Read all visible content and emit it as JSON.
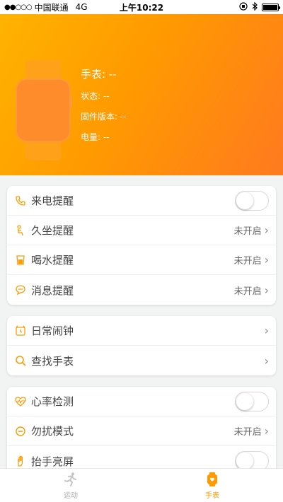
{
  "status_bar": {
    "carrier": "中国联通",
    "network": "4G",
    "time": "上午10:22"
  },
  "device": {
    "name": "手表: --",
    "status": "状态: --",
    "firmware": "固件版本: --",
    "battery": "电量: --"
  },
  "colors": {
    "accent": "#ff9a00",
    "header_start": "#ffb300",
    "header_end": "#ff7a1f"
  },
  "group1": {
    "call_reminder": {
      "label": "来电提醒",
      "icon": "phone-icon",
      "toggle": false
    },
    "sedentary": {
      "label": "久坐提醒",
      "icon": "seated-person-icon",
      "value": "未开启"
    },
    "drink_water": {
      "label": "喝水提醒",
      "icon": "cup-icon",
      "value": "未开启"
    },
    "message": {
      "label": "消息提醒",
      "icon": "message-icon",
      "value": "未开启"
    }
  },
  "group2": {
    "alarm": {
      "label": "日常闹钟",
      "icon": "alarm-clock-icon"
    },
    "find_watch": {
      "label": "查找手表",
      "icon": "search-icon"
    }
  },
  "group3": {
    "heart_rate": {
      "label": "心率检测",
      "icon": "heart-rate-icon",
      "toggle": false
    },
    "dnd": {
      "label": "勿扰模式",
      "icon": "minus-circle-icon",
      "value": "未开启"
    },
    "raise_wake": {
      "label": "抬手亮屏",
      "icon": "raise-hand-icon",
      "toggle": false
    }
  },
  "tabs": {
    "sport": {
      "label": "运动",
      "icon": "running-icon"
    },
    "watch": {
      "label": "手表",
      "icon": "watch-icon"
    }
  }
}
